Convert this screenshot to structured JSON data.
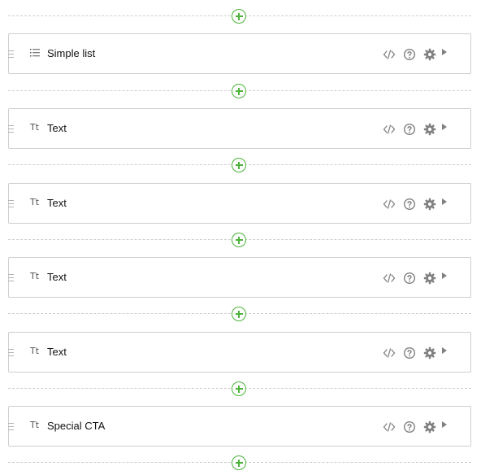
{
  "add_block_icon": "plus-circle-icon",
  "accent_color": "#4cb33a",
  "blocks": [
    {
      "label": "Simple list",
      "type_icon": "list-icon"
    },
    {
      "label": "Text",
      "type_icon": "text-icon",
      "type_glyph": "Tt"
    },
    {
      "label": "Text",
      "type_icon": "text-icon",
      "type_glyph": "Tt"
    },
    {
      "label": "Text",
      "type_icon": "text-icon",
      "type_glyph": "Tt"
    },
    {
      "label": "Text",
      "type_icon": "text-icon",
      "type_glyph": "Tt"
    },
    {
      "label": "Special CTA",
      "type_icon": "text-icon",
      "type_glyph": "Tt"
    }
  ],
  "block_tools": [
    "code-icon",
    "help-icon",
    "gear-icon",
    "play-icon"
  ]
}
